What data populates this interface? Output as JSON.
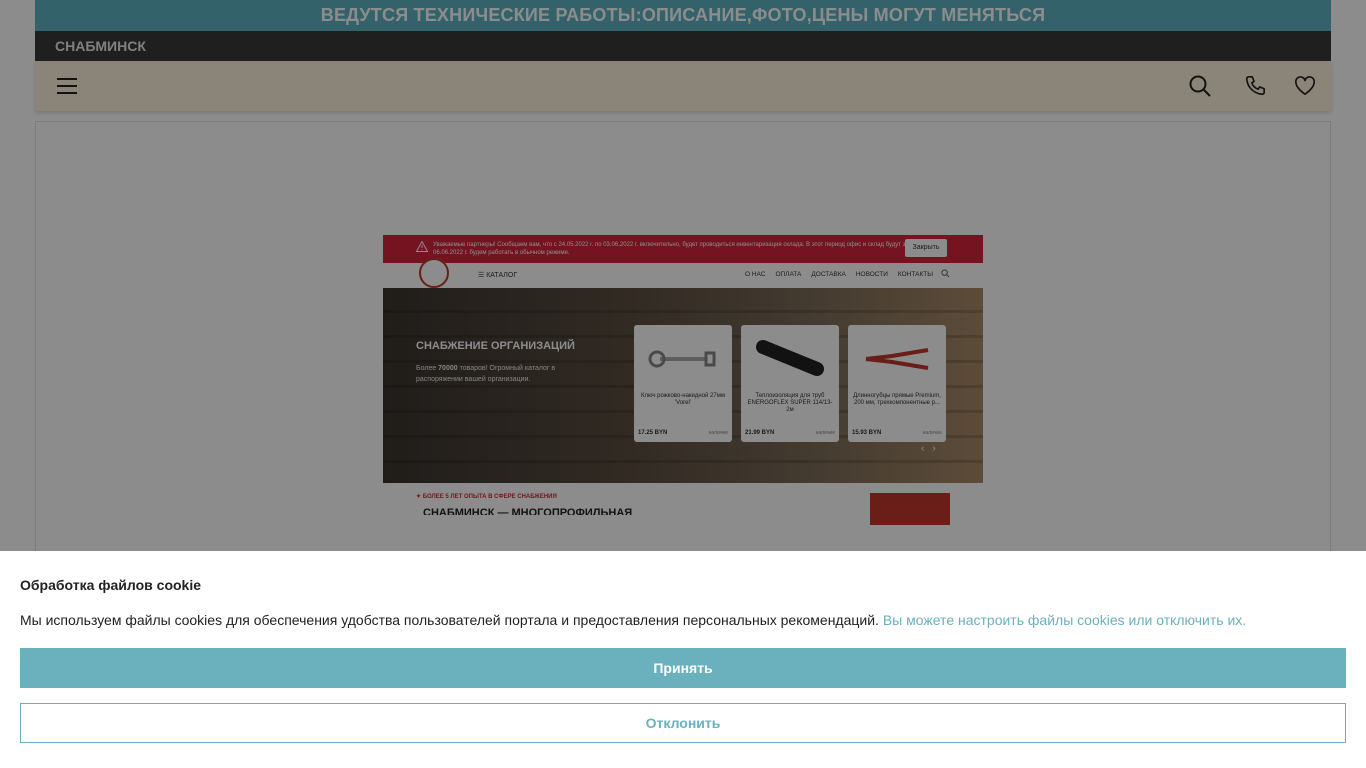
{
  "notice": "ВЕДУТСЯ ТЕХНИЧЕСКИЕ РАБОТЫ:ОПИСАНИЕ,ФОТО,ЦЕНЫ МОГУТ МЕНЯТЬСЯ",
  "brand": "СНАБМИНСК",
  "header": {
    "menu_icon": "hamburger-menu-icon",
    "search_icon": "search-icon",
    "phone_icon": "phone-icon",
    "favorites_icon": "heart-icon"
  },
  "preview": {
    "alert_text": "Уважаемые партнеры! Сообщаем вам, что с 24.05.2022 г. по 03.06.2022 г. включительно, будет проводиться инвентаризация склада. В этот период офис и склад будут закрыты. С 06.06.2022 г. будем работать в обычном режиме.",
    "alert_close": "Закрыть",
    "catalog": "КАТАЛОГ",
    "menu": [
      "О НАС",
      "ОПЛАТА",
      "ДОСТАВКА",
      "НОВОСТИ",
      "КОНТАКТЫ"
    ],
    "hero_title": "СНАБЖЕНИЕ ОРГАНИЗАЦИЙ",
    "hero_sub_before": "Более ",
    "hero_sub_number": "70000",
    "hero_sub_after": " товаров! Огромный каталог в распоряжении вашей организации.",
    "cards": [
      {
        "name": "Ключ рожково-накидной 27мм 'Vorel'",
        "price": "17.25 BYN",
        "avail": "наличие"
      },
      {
        "name": "Теплоизоляция для труб ENERGOFLEX SUPER 114/13-2м",
        "price": "21.99 BYN",
        "avail": "наличие"
      },
      {
        "name": "Длинногубцы прямые Premium, 200 мм, трехкомпонентные р...",
        "price": "15.93 BYN",
        "avail": "наличие"
      }
    ],
    "experience": "БОЛЕЕ 5 ЛЕТ ОПЫТА В СФЕРЕ СНАБЖЕНИЯ",
    "heading": "СНАБМИНСК — МНОГОПРОФИЛЬНАЯ"
  },
  "cookie": {
    "title": "Обработка файлов cookie",
    "text": "Мы используем файлы cookies для обеспечения удобства пользователей портала и предоставления персональных рекомендаций.",
    "link": "Вы можете настроить файлы cookies или отключить их.",
    "accept": "Принять",
    "decline": "Отклонить"
  },
  "colors": {
    "accent": "#6ab1bd",
    "notice_bg": "#5fb3c2",
    "brand_bg": "#3a3a3a",
    "header_bg": "#fdf3dc"
  }
}
